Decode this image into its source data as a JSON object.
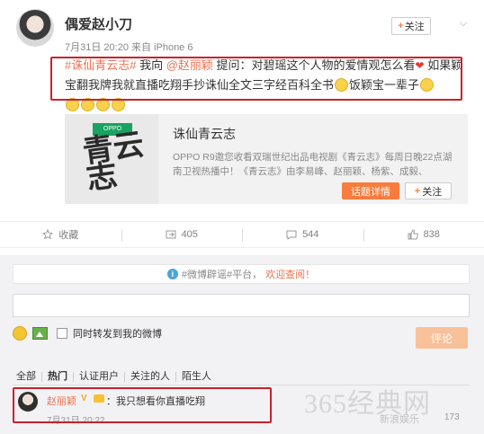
{
  "post": {
    "username": "偶爱赵小刀",
    "meta": "7月31日 20:20 来自 iPhone 6",
    "follow_label": "关注",
    "text": {
      "hashtag": "#诛仙青云志#",
      "p1": " 我向 ",
      "mention": "@赵丽颖",
      "p2": " 提问：对碧瑶这个人物的爱情观怎么看",
      "p3": " 如果颖宝翻我牌我就直播吃翔手抄诛仙全文三字经百科全书",
      "p4": "饭颖宝一辈子"
    }
  },
  "share_card": {
    "thumb_brand": "OPPO",
    "thumb_calligraphy": "青云志",
    "title": "诛仙青云志",
    "description": "OPPO R9邀您收看双瑞世纪出品电视剧《青云志》每周日晚22点湖南卫视热播中！《青云志》由李易峰、赵丽颖、杨紫、成毅、",
    "topic_button": "话题详情",
    "follow_button": "关注"
  },
  "actions": [
    {
      "label": "收藏",
      "icon": "star-icon"
    },
    {
      "label": "405",
      "icon": "repost-icon"
    },
    {
      "label": "544",
      "icon": "comment-icon"
    },
    {
      "label": "838",
      "icon": "like-icon"
    }
  ],
  "comments": {
    "notice_tag": "#微博辟谣#平台，",
    "notice_highlight": "欢迎查阅！",
    "repost_checkbox_label": "同时转发到我的微博",
    "submit_label": "评论",
    "filters": [
      "全部",
      "热门",
      "认证用户",
      "关注的人",
      "陌生人"
    ],
    "item": {
      "user": "赵丽颖",
      "text": "：我只想看你直播吃翔",
      "time": "7月31日 20:22",
      "likes": "173"
    }
  },
  "watermark": {
    "main": "365经典网",
    "sub": "新浪娱乐"
  },
  "colors": {
    "accent": "#eb7350",
    "highlight_box": "#c8232c",
    "button_orange": "#f77c3d"
  }
}
